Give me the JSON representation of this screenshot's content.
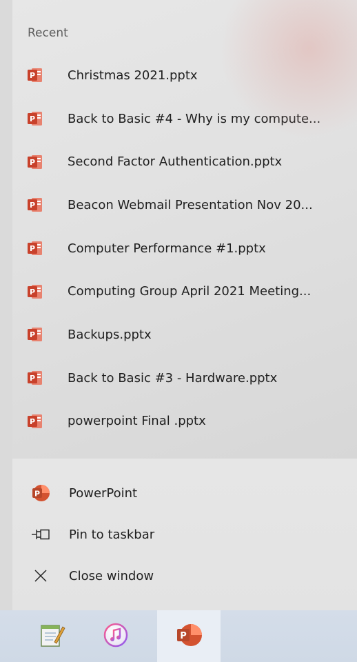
{
  "recent": {
    "title": "Recent",
    "items": [
      {
        "label": "Christmas 2021.pptx"
      },
      {
        "label": "Back to Basic #4 - Why is my compute..."
      },
      {
        "label": "Second Factor Authentication.pptx"
      },
      {
        "label": "Beacon Webmail Presentation Nov 20..."
      },
      {
        "label": "Computer Performance #1.pptx"
      },
      {
        "label": "Computing Group April 2021 Meeting..."
      },
      {
        "label": "Backups.pptx"
      },
      {
        "label": "Back to Basic #3 - Hardware.pptx"
      },
      {
        "label": "powerpoint Final .pptx"
      }
    ]
  },
  "actions": {
    "app_label": "PowerPoint",
    "pin_label": "Pin to taskbar",
    "close_label": "Close window"
  },
  "taskbar": {
    "apps": [
      {
        "name": "notepad-app",
        "icon": "notepad-icon"
      },
      {
        "name": "itunes-app",
        "icon": "itunes-icon"
      },
      {
        "name": "powerpoint-app",
        "icon": "powerpoint-icon",
        "active": true
      }
    ]
  },
  "colors": {
    "powerpoint_accent": "#c8412b",
    "recent_bg": "#e1e1e1",
    "taskbar_bg": "#d2dbe7"
  }
}
